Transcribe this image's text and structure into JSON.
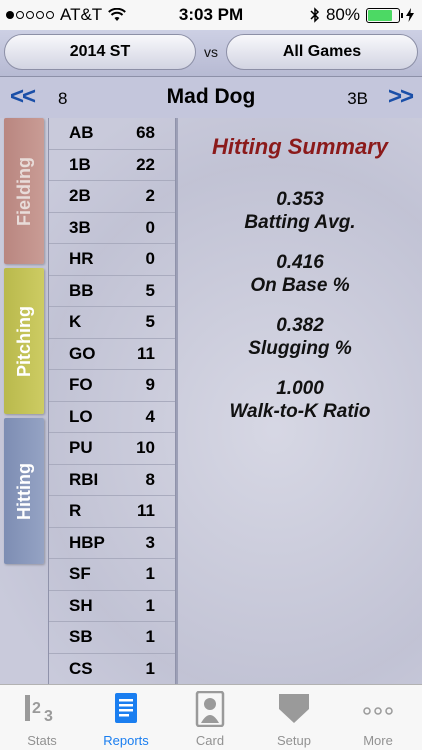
{
  "status_bar": {
    "carrier": "AT&T",
    "time": "3:03 PM",
    "battery": "80%",
    "battery_level": 0.8
  },
  "selector": {
    "left": "2014 ST",
    "vs": "vs",
    "right": "All Games"
  },
  "player": {
    "prev": "<<",
    "number": "8",
    "name": "Mad Dog",
    "position": "3B",
    "next": ">>"
  },
  "side_tabs": [
    "Fielding",
    "Pitching",
    "Hitting"
  ],
  "stats": [
    {
      "label": "AB",
      "value": "68"
    },
    {
      "label": "1B",
      "value": "22"
    },
    {
      "label": "2B",
      "value": "2"
    },
    {
      "label": "3B",
      "value": "0"
    },
    {
      "label": "HR",
      "value": "0"
    },
    {
      "label": "BB",
      "value": "5"
    },
    {
      "label": "K",
      "value": "5"
    },
    {
      "label": "GO",
      "value": "11"
    },
    {
      "label": "FO",
      "value": "9"
    },
    {
      "label": "LO",
      "value": "4"
    },
    {
      "label": "PU",
      "value": "10"
    },
    {
      "label": "RBI",
      "value": "8"
    },
    {
      "label": "R",
      "value": "11"
    },
    {
      "label": "HBP",
      "value": "3"
    },
    {
      "label": "SF",
      "value": "1"
    },
    {
      "label": "SH",
      "value": "1"
    },
    {
      "label": "SB",
      "value": "1"
    },
    {
      "label": "CS",
      "value": "1"
    }
  ],
  "summary": {
    "title": "Hitting Summary",
    "metrics": [
      {
        "value": "0.353",
        "label": "Batting Avg."
      },
      {
        "value": "0.416",
        "label": "On Base %"
      },
      {
        "value": "0.382",
        "label": "Slugging %"
      },
      {
        "value": "1.000",
        "label": "Walk-to-K Ratio"
      }
    ]
  },
  "tab_bar": {
    "items": [
      {
        "label": "Stats",
        "icon": "stats-123-icon"
      },
      {
        "label": "Reports",
        "icon": "reports-doc-icon"
      },
      {
        "label": "Card",
        "icon": "player-card-icon"
      },
      {
        "label": "Setup",
        "icon": "home-plate-icon"
      },
      {
        "label": "More",
        "icon": "more-dots-icon"
      }
    ],
    "active": "Reports"
  },
  "colors": {
    "title_red": "#8b1a1a",
    "nav_blue": "#1a4fa8",
    "active_tab": "#1a7ef0",
    "fielding_tab": "#b98680",
    "pitching_tab": "#b9b94c",
    "hitting_tab": "#7d8db3"
  }
}
